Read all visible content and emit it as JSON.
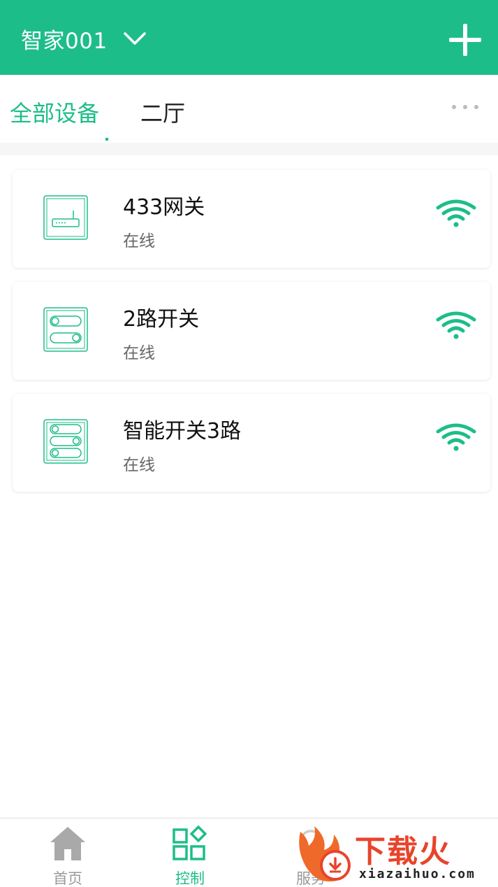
{
  "header": {
    "home_name": "智家001"
  },
  "tabs": [
    {
      "label": "全部设备",
      "active": true
    },
    {
      "label": "二厅",
      "active": false
    }
  ],
  "devices": [
    {
      "name": "433网关",
      "status": "在线",
      "icon": "gateway-icon"
    },
    {
      "name": "2路开关",
      "status": "在线",
      "icon": "two-way-switch-icon"
    },
    {
      "name": "智能开关3路",
      "status": "在线",
      "icon": "three-way-switch-icon"
    }
  ],
  "bottom_nav": [
    {
      "label": "首页",
      "icon": "home-icon",
      "active": false
    },
    {
      "label": "控制",
      "icon": "control-grid-icon",
      "active": true
    },
    {
      "label": "服务",
      "icon": "service-icon",
      "active": false
    }
  ],
  "watermark": {
    "text": "下载火",
    "sub": "xiazaihuo.com"
  },
  "colors": {
    "accent": "#1dbd89",
    "text": "#111111",
    "muted": "#666666",
    "nav_inactive": "#999999"
  }
}
